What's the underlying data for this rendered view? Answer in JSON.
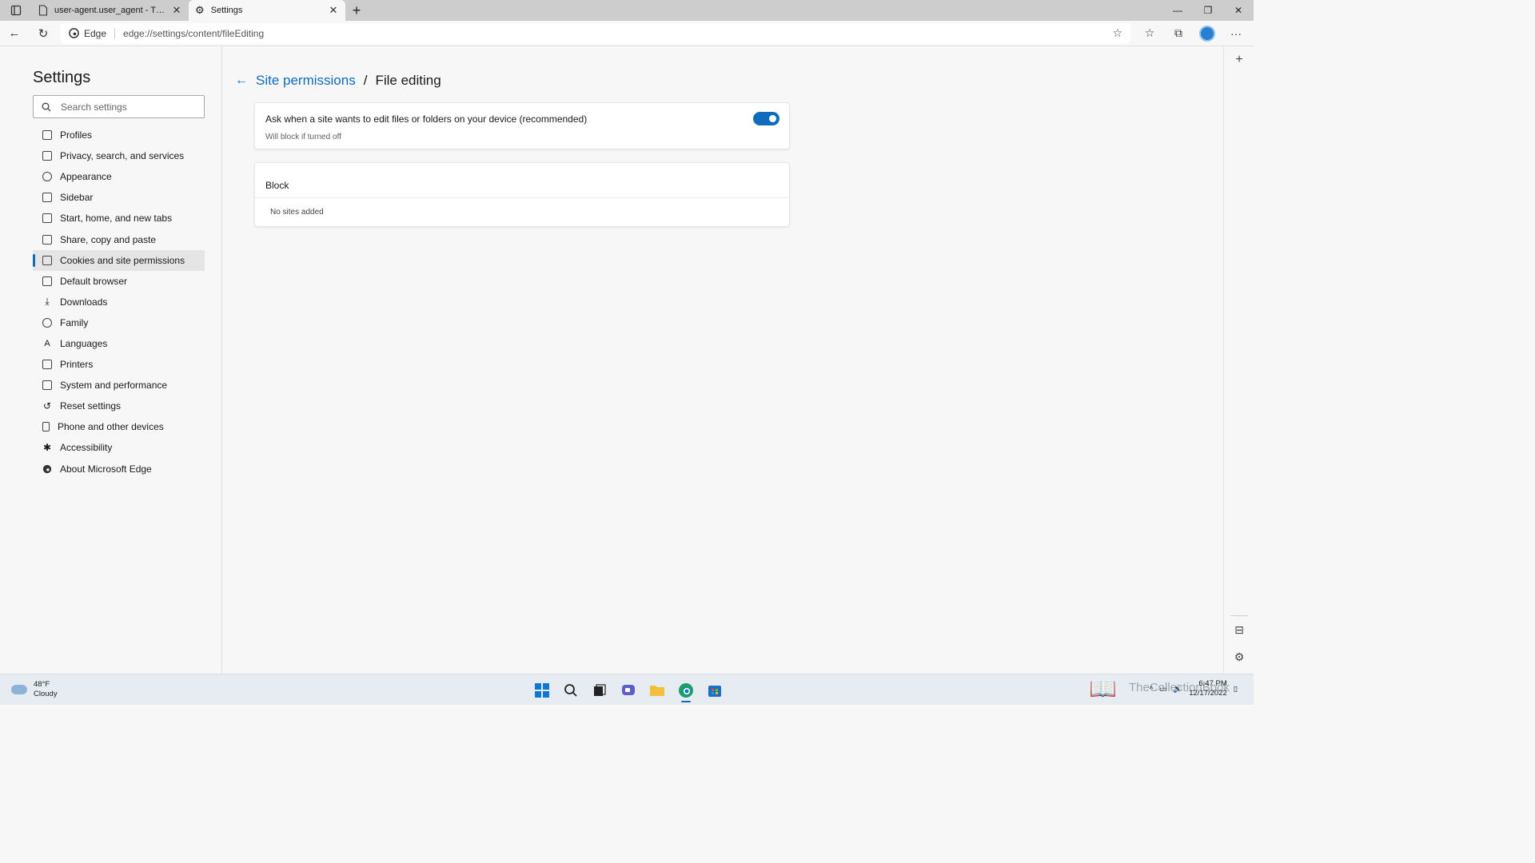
{
  "tabs": [
    {
      "title": "user-agent.user_agent - The Coll",
      "icon": "page-icon",
      "active": false
    },
    {
      "title": "Settings",
      "icon": "gear-icon",
      "active": true
    }
  ],
  "address": {
    "badge": "Edge",
    "url": "edge://settings/content/fileEditing"
  },
  "sidebar": {
    "title": "Settings",
    "search_placeholder": "Search settings",
    "items": [
      {
        "label": "Profiles",
        "icon": "profile-icon"
      },
      {
        "label": "Privacy, search, and services",
        "icon": "lock-icon"
      },
      {
        "label": "Appearance",
        "icon": "appearance-icon"
      },
      {
        "label": "Sidebar",
        "icon": "sidebar-icon"
      },
      {
        "label": "Start, home, and new tabs",
        "icon": "home-icon"
      },
      {
        "label": "Share, copy and paste",
        "icon": "share-icon"
      },
      {
        "label": "Cookies and site permissions",
        "icon": "cookies-icon",
        "selected": true
      },
      {
        "label": "Default browser",
        "icon": "browser-icon"
      },
      {
        "label": "Downloads",
        "icon": "download-icon"
      },
      {
        "label": "Family",
        "icon": "family-icon"
      },
      {
        "label": "Languages",
        "icon": "language-icon"
      },
      {
        "label": "Printers",
        "icon": "printer-icon"
      },
      {
        "label": "System and performance",
        "icon": "laptop-icon"
      },
      {
        "label": "Reset settings",
        "icon": "reset-icon"
      },
      {
        "label": "Phone and other devices",
        "icon": "phone-icon"
      },
      {
        "label": "Accessibility",
        "icon": "accessibility-icon"
      },
      {
        "label": "About Microsoft Edge",
        "icon": "edge-icon"
      }
    ]
  },
  "main": {
    "breadcrumb_parent": "Site permissions",
    "breadcrumb_sep": "/",
    "breadcrumb_current": "File editing",
    "ask_title": "Ask when a site wants to edit files or folders on your device (recommended)",
    "ask_subtitle": "Will block if turned off",
    "ask_enabled": true,
    "block_heading": "Block",
    "block_empty": "No sites added"
  },
  "taskbar": {
    "temperature": "48°F",
    "condition": "Cloudy",
    "time": "6:47 PM",
    "date": "12/17/2022",
    "watermark": "TheCollectionBook"
  },
  "colors": {
    "accent": "#0f6cbd"
  }
}
